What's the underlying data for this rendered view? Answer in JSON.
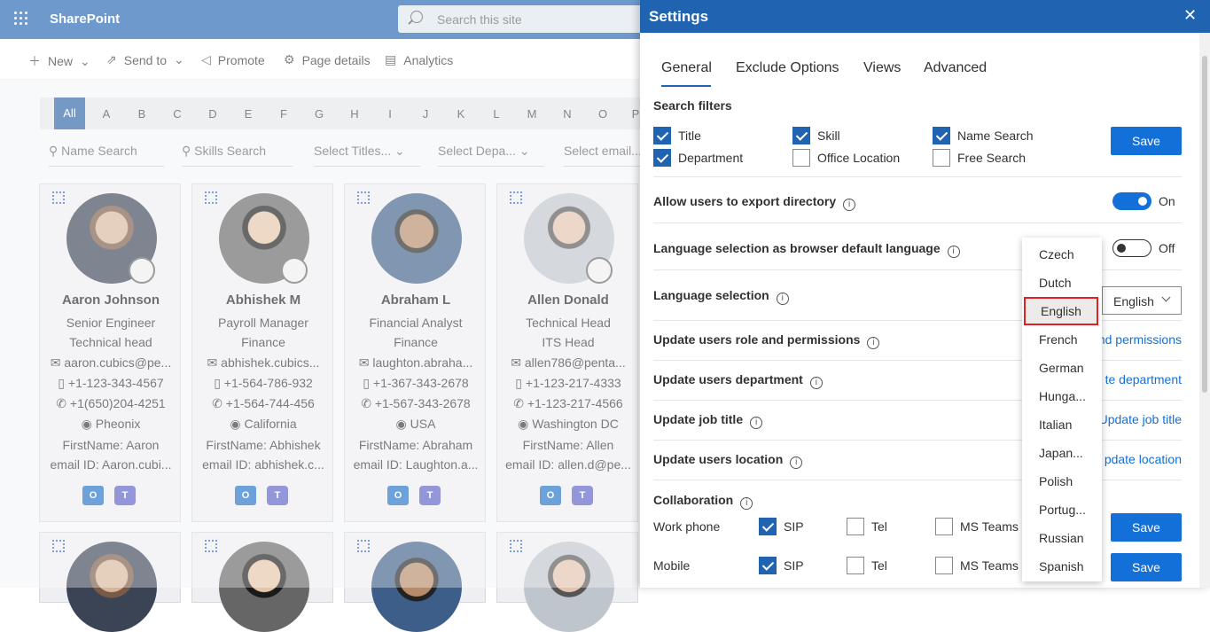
{
  "suite": {
    "brand": "SharePoint",
    "search_placeholder": "Search this site"
  },
  "command_bar": {
    "new": "New",
    "send_to": "Send to",
    "promote": "Promote",
    "page_details": "Page details",
    "analytics": "Analytics"
  },
  "alphabet": {
    "all": "All",
    "letters": [
      "A",
      "B",
      "C",
      "D",
      "E",
      "F",
      "G",
      "H",
      "I",
      "J",
      "K",
      "L",
      "M",
      "N",
      "O",
      "P"
    ]
  },
  "filters": {
    "name_search": "Name Search",
    "skills_search": "Skills Search",
    "titles": "Select Titles...",
    "department": "Select Depa...",
    "email": "Select email..."
  },
  "cards": [
    {
      "name": "Aaron Johnson",
      "title": "Senior Engineer",
      "department": "Technical head",
      "email": "aaron.cubics@pe...",
      "phone1": "+1-123-343-4567",
      "phone2": "+1(650)204-4251",
      "location": "Pheonix",
      "firstname": "FirstName: Aaron",
      "email_id": "email ID: Aaron.cubi..."
    },
    {
      "name": "Abhishek M",
      "title": "Payroll Manager",
      "department": "Finance",
      "email": "abhishek.cubics...",
      "phone1": "+1-564-786-932",
      "phone2": "+1-564-744-456",
      "location": "California",
      "firstname": "FirstName: Abhishek",
      "email_id": "email ID: abhishek.c..."
    },
    {
      "name": "Abraham L",
      "title": "Financial Analyst",
      "department": "Finance",
      "email": "laughton.abraha...",
      "phone1": "+1-367-343-2678",
      "phone2": "+1-567-343-2678",
      "location": "USA",
      "firstname": "FirstName: Abraham",
      "email_id": "email ID: Laughton.a..."
    },
    {
      "name": "Allen Donald",
      "title": "Technical Head",
      "department": "ITS Head",
      "email": "allen786@penta...",
      "phone1": "+1-123-217-4333",
      "phone2": "+1-123-217-4566",
      "location": "Washington DC",
      "firstname": "FirstName: Allen",
      "email_id": "email ID: allen.d@pe..."
    }
  ],
  "settings": {
    "title": "Settings",
    "close": "✕",
    "tabs": [
      "General",
      "Exclude Options",
      "Views",
      "Advanced"
    ],
    "search_filters": {
      "heading": "Search filters",
      "items": [
        {
          "label": "Title",
          "checked": true
        },
        {
          "label": "Department",
          "checked": true
        },
        {
          "label": "Skill",
          "checked": true
        },
        {
          "label": "Office Location",
          "checked": false
        },
        {
          "label": "Name Search",
          "checked": true
        },
        {
          "label": "Free Search",
          "checked": false
        }
      ],
      "save": "Save"
    },
    "export": {
      "label": "Allow users to export directory",
      "state": "On"
    },
    "browser_lang": {
      "label": "Language selection as browser default language",
      "state": "Off"
    },
    "lang_selection": {
      "label": "Language selection",
      "value": "English"
    },
    "role_perm": {
      "label": "Update users role and permissions",
      "link": "nd permissions"
    },
    "dept": {
      "label": "Update users department",
      "link": "te department"
    },
    "job": {
      "label": "Update job title",
      "link": "Update job title"
    },
    "location": {
      "label": "Update users location",
      "link": "pdate location"
    },
    "collaboration": {
      "heading": "Collaboration",
      "rows": [
        {
          "label": "Work phone",
          "sip": "SIP",
          "tel": "Tel",
          "teams": "MS Teams",
          "save": "Save"
        },
        {
          "label": "Mobile",
          "sip": "SIP",
          "tel": "Tel",
          "teams": "MS Teams",
          "save": "Save"
        }
      ]
    },
    "language_options": [
      "Czech",
      "Dutch",
      "English",
      "French",
      "German",
      "Hunga...",
      "Italian",
      "Japan...",
      "Polish",
      "Portug...",
      "Russian",
      "Spanish"
    ],
    "selected_language_index": 2
  }
}
